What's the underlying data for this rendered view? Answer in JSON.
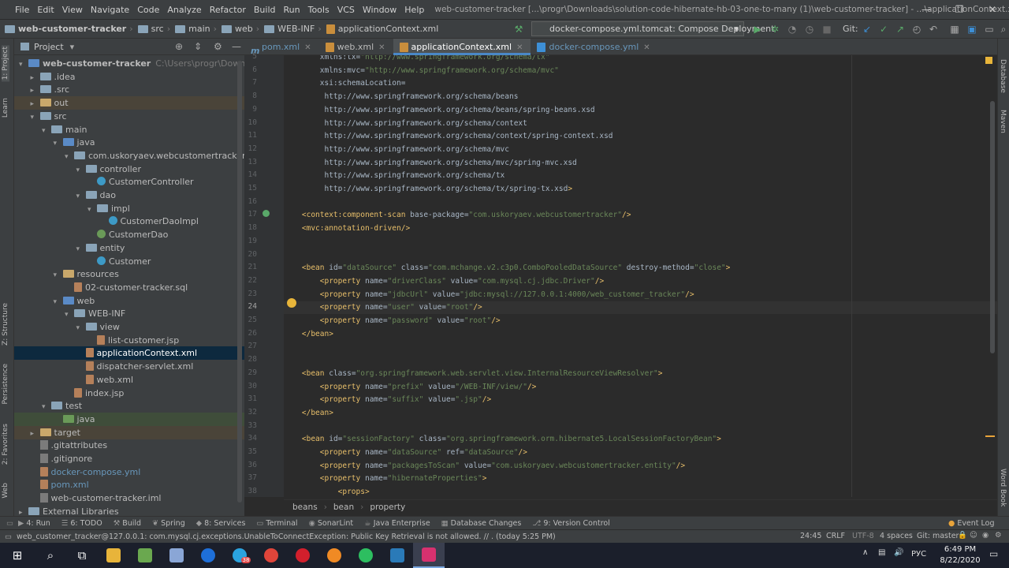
{
  "window": {
    "menu": [
      "File",
      "Edit",
      "View",
      "Navigate",
      "Code",
      "Analyze",
      "Refactor",
      "Build",
      "Run",
      "Tools",
      "VCS",
      "Window",
      "Help"
    ],
    "title": "web-customer-tracker [...\\progr\\Downloads\\solution-code-hibernate-hb-03-one-to-many (1)\\web-customer-tracker] - ...\\applicationContext.xml"
  },
  "toolbar": {
    "breadcrumb": [
      "web-customer-tracker",
      "src",
      "main",
      "web",
      "WEB-INF",
      "applicationContext.xml"
    ],
    "run_config": "docker-compose.yml.tomcat: Compose Deployment",
    "git_label": "Git:"
  },
  "left_strip": {
    "labels": [
      "1: Project",
      "Learn",
      "Z: Structure",
      "Persistence",
      "2: Favorites",
      "Web"
    ]
  },
  "right_strip": {
    "labels": [
      "Database",
      "Maven",
      "Word Book"
    ]
  },
  "project": {
    "header": "Project",
    "tree": [
      {
        "label": "web-customer-tracker",
        "extra": "C:\\Users\\progr\\Downloads\\solutio",
        "depth": 0,
        "arrow": "▾",
        "icon": "bl",
        "bold": true
      },
      {
        "label": ".idea",
        "depth": 1,
        "arrow": "▸",
        "icon": "fd"
      },
      {
        "label": ".src",
        "depth": 1,
        "arrow": "▸",
        "icon": "fd"
      },
      {
        "label": "out",
        "depth": 1,
        "arrow": "▸",
        "icon": "or",
        "hl": true
      },
      {
        "label": "src",
        "depth": 1,
        "arrow": "▾",
        "icon": "fd"
      },
      {
        "label": "main",
        "depth": 2,
        "arrow": "▾",
        "icon": "fd"
      },
      {
        "label": "java",
        "depth": 3,
        "arrow": "▾",
        "icon": "bl"
      },
      {
        "label": "com.uskoryaev.webcustomertracker",
        "depth": 4,
        "arrow": "▾",
        "icon": "fd"
      },
      {
        "label": "controller",
        "depth": 5,
        "arrow": "▾",
        "icon": "fd"
      },
      {
        "label": "CustomerController",
        "depth": 6,
        "icon": "cls"
      },
      {
        "label": "dao",
        "depth": 5,
        "arrow": "▾",
        "icon": "fd"
      },
      {
        "label": "impl",
        "depth": 6,
        "arrow": "▾",
        "icon": "fd"
      },
      {
        "label": "CustomerDaoImpl",
        "depth": 7,
        "icon": "cls"
      },
      {
        "label": "CustomerDao",
        "depth": 6,
        "icon": "itf"
      },
      {
        "label": "entity",
        "depth": 5,
        "arrow": "▾",
        "icon": "fd"
      },
      {
        "label": "Customer",
        "depth": 6,
        "icon": "cls"
      },
      {
        "label": "resources",
        "depth": 3,
        "arrow": "▾",
        "icon": "or"
      },
      {
        "label": "02-customer-tracker.sql",
        "depth": 4,
        "icon": "fi"
      },
      {
        "label": "web",
        "depth": 3,
        "arrow": "▾",
        "icon": "bl"
      },
      {
        "label": "WEB-INF",
        "depth": 4,
        "arrow": "▾",
        "icon": "fd"
      },
      {
        "label": "view",
        "depth": 5,
        "arrow": "▾",
        "icon": "fd"
      },
      {
        "label": "list-customer.jsp",
        "depth": 6,
        "icon": "fi"
      },
      {
        "label": "applicationContext.xml",
        "depth": 5,
        "icon": "fi",
        "sel": true
      },
      {
        "label": "dispatcher-servlet.xml",
        "depth": 5,
        "icon": "fi"
      },
      {
        "label": "web.xml",
        "depth": 5,
        "icon": "fi"
      },
      {
        "label": "index.jsp",
        "depth": 4,
        "icon": "fi"
      },
      {
        "label": "test",
        "depth": 2,
        "arrow": "▾",
        "icon": "fd"
      },
      {
        "label": "java",
        "depth": 3,
        "icon": "gr",
        "hlg": true
      },
      {
        "label": "target",
        "depth": 1,
        "arrow": "▸",
        "icon": "or",
        "hl": true
      },
      {
        "label": ".gitattributes",
        "depth": 1,
        "icon": "gi"
      },
      {
        "label": ".gitignore",
        "depth": 1,
        "icon": "gi"
      },
      {
        "label": "docker-compose.yml",
        "depth": 1,
        "icon": "fi",
        "blue": true
      },
      {
        "label": "pom.xml",
        "depth": 1,
        "icon": "fi",
        "blue": true
      },
      {
        "label": "web-customer-tracker.iml",
        "depth": 1,
        "icon": "gi"
      },
      {
        "label": "External Libraries",
        "depth": 0,
        "arrow": "▸",
        "icon": "fd"
      }
    ]
  },
  "tabs": [
    {
      "label": "pom.xml"
    },
    {
      "label": "web.xml"
    },
    {
      "label": "applicationContext.xml",
      "active": true
    },
    {
      "label": "docker-compose.yml"
    }
  ],
  "editor": {
    "current_line": 24,
    "lines": [
      {
        "n": 5,
        "t": "        xmlns:tx=\"http://www.springframework.org/schema/tx\""
      },
      {
        "n": 6,
        "t": "        xmlns:mvc=\"http://www.springframework.org/schema/mvc\""
      },
      {
        "n": 7,
        "t": "        xsi:schemaLocation=\""
      },
      {
        "n": 8,
        "t": "         http://www.springframework.org/schema/beans"
      },
      {
        "n": 9,
        "t": "         http://www.springframework.org/schema/beans/spring-beans.xsd"
      },
      {
        "n": 10,
        "t": "         http://www.springframework.org/schema/context"
      },
      {
        "n": 11,
        "t": "         http://www.springframework.org/schema/context/spring-context.xsd"
      },
      {
        "n": 12,
        "t": "         http://www.springframework.org/schema/mvc"
      },
      {
        "n": 13,
        "t": "         http://www.springframework.org/schema/mvc/spring-mvc.xsd"
      },
      {
        "n": 14,
        "t": "         http://www.springframework.org/schema/tx"
      },
      {
        "n": 15,
        "t": "         http://www.springframework.org/schema/tx/spring-tx.xsd\">"
      },
      {
        "n": 16,
        "t": ""
      },
      {
        "n": 17,
        "t": "    <context:component-scan base-package=\"com.uskoryaev.webcustomertracker\"/>"
      },
      {
        "n": 18,
        "t": "    <mvc:annotation-driven/>"
      },
      {
        "n": 19,
        "t": ""
      },
      {
        "n": 20,
        "t": ""
      },
      {
        "n": 21,
        "t": "    <bean id=\"dataSource\" class=\"com.mchange.v2.c3p0.ComboPooledDataSource\" destroy-method=\"close\">"
      },
      {
        "n": 22,
        "t": "        <property name=\"driverClass\" value=\"com.mysql.cj.jdbc.Driver\"/>"
      },
      {
        "n": 23,
        "t": "        <property name=\"jdbcUrl\" value=\"jdbc:mysql://127.0.0.1:4000/web_customer_tracker\"/>"
      },
      {
        "n": 24,
        "t": "        <property name=\"user\" value=\"root\"/>"
      },
      {
        "n": 25,
        "t": "        <property name=\"password\" value=\"root\"/>"
      },
      {
        "n": 26,
        "t": "    </bean>"
      },
      {
        "n": 27,
        "t": ""
      },
      {
        "n": 28,
        "t": ""
      },
      {
        "n": 29,
        "t": "    <bean class=\"org.springframework.web.servlet.view.InternalResourceViewResolver\">"
      },
      {
        "n": 30,
        "t": "        <property name=\"prefix\" value=\"/WEB-INF/view/\"/>"
      },
      {
        "n": 31,
        "t": "        <property name=\"suffix\" value=\".jsp\"/>"
      },
      {
        "n": 32,
        "t": "    </bean>"
      },
      {
        "n": 33,
        "t": ""
      },
      {
        "n": 34,
        "t": "    <bean id=\"sessionFactory\" class=\"org.springframework.orm.hibernate5.LocalSessionFactoryBean\">"
      },
      {
        "n": 35,
        "t": "        <property name=\"dataSource\" ref=\"dataSource\"/>"
      },
      {
        "n": 36,
        "t": "        <property name=\"packagesToScan\" value=\"com.uskoryaev.webcustomertracker.entity\"/>"
      },
      {
        "n": 37,
        "t": "        <property name=\"hibernateProperties\">"
      },
      {
        "n": 38,
        "t": "            <props>"
      }
    ]
  },
  "code_breadcrumb": [
    "beans",
    "bean",
    "property"
  ],
  "tool_windows": [
    "4: Run",
    "6: TODO",
    "Build",
    "Spring",
    "8: Services",
    "Terminal",
    "SonarLint",
    "Java Enterprise",
    "Database Changes",
    "9: Version Control"
  ],
  "event_log": "Event Log",
  "status": {
    "message": "web_customer_tracker@127.0.0.1: com.mysql.cj.exceptions.UnableToConnectException: Public Key Retrieval is not allowed. // . (today 5:25 PM)",
    "position": "24:45",
    "line_sep": "CRLF",
    "encoding": "UTF-8",
    "indent": "4 spaces",
    "git": "Git: master"
  },
  "taskbar": {
    "lang": "РУС",
    "time": "6:49 PM",
    "date": "8/22/2020",
    "telegram_badge": "38",
    "apps": [
      "search",
      "taskview",
      "explorer",
      "notepad",
      "snipping",
      "teamviewer",
      "telegram",
      "chrome",
      "opera",
      "firefox",
      "evernote",
      "vscode",
      "intellij"
    ]
  },
  "colors": {
    "accent": "#4a88c7",
    "selection": "#0d293e",
    "bg": "#2b2b2b",
    "panel": "#3c3f41"
  }
}
